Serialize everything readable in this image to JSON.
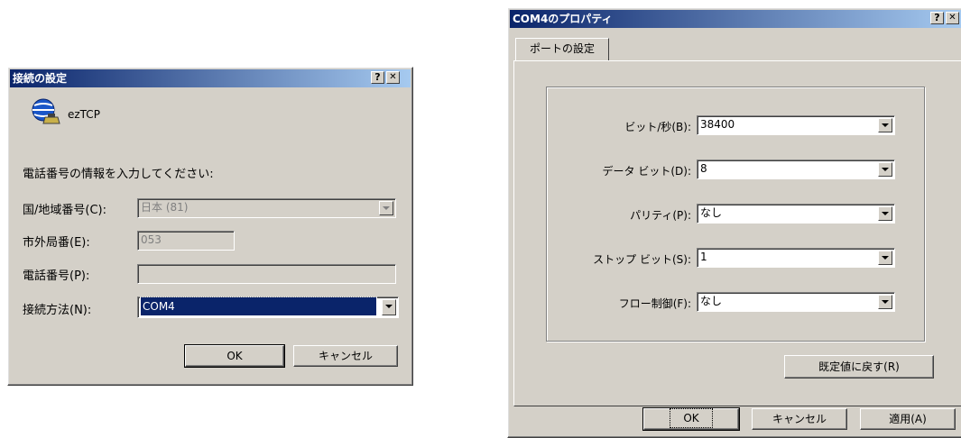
{
  "connect_dialog": {
    "title": "接続の設定",
    "help_button": "?",
    "close_button": "✕",
    "connection_name": "ezTCP",
    "instruction": "電話番号の情報を入力してください:",
    "country_label": "国/地域番号(C):",
    "country_value": "日本 (81)",
    "area_code_label": "市外局番(E):",
    "area_code_value": "053",
    "phone_label": "電話番号(P):",
    "phone_value": "",
    "connect_using_label": "接続方法(N):",
    "connect_using_value": "COM4",
    "ok_label": "OK",
    "cancel_label": "キャンセル"
  },
  "port_dialog": {
    "title": "COM4のプロパティ",
    "help_button": "?",
    "close_button": "✕",
    "tab_label": "ポートの設定",
    "fields": [
      {
        "label": "ビット/秒(B):",
        "value": "38400"
      },
      {
        "label": "データ ビット(D):",
        "value": "8"
      },
      {
        "label": "パリティ(P):",
        "value": "なし"
      },
      {
        "label": "ストップ ビット(S):",
        "value": "1"
      },
      {
        "label": "フロー制御(F):",
        "value": "なし"
      }
    ],
    "restore_defaults_label": "既定値に戻す(R)",
    "ok_label": "OK",
    "cancel_label": "キャンセル",
    "apply_label": "適用(A)"
  }
}
